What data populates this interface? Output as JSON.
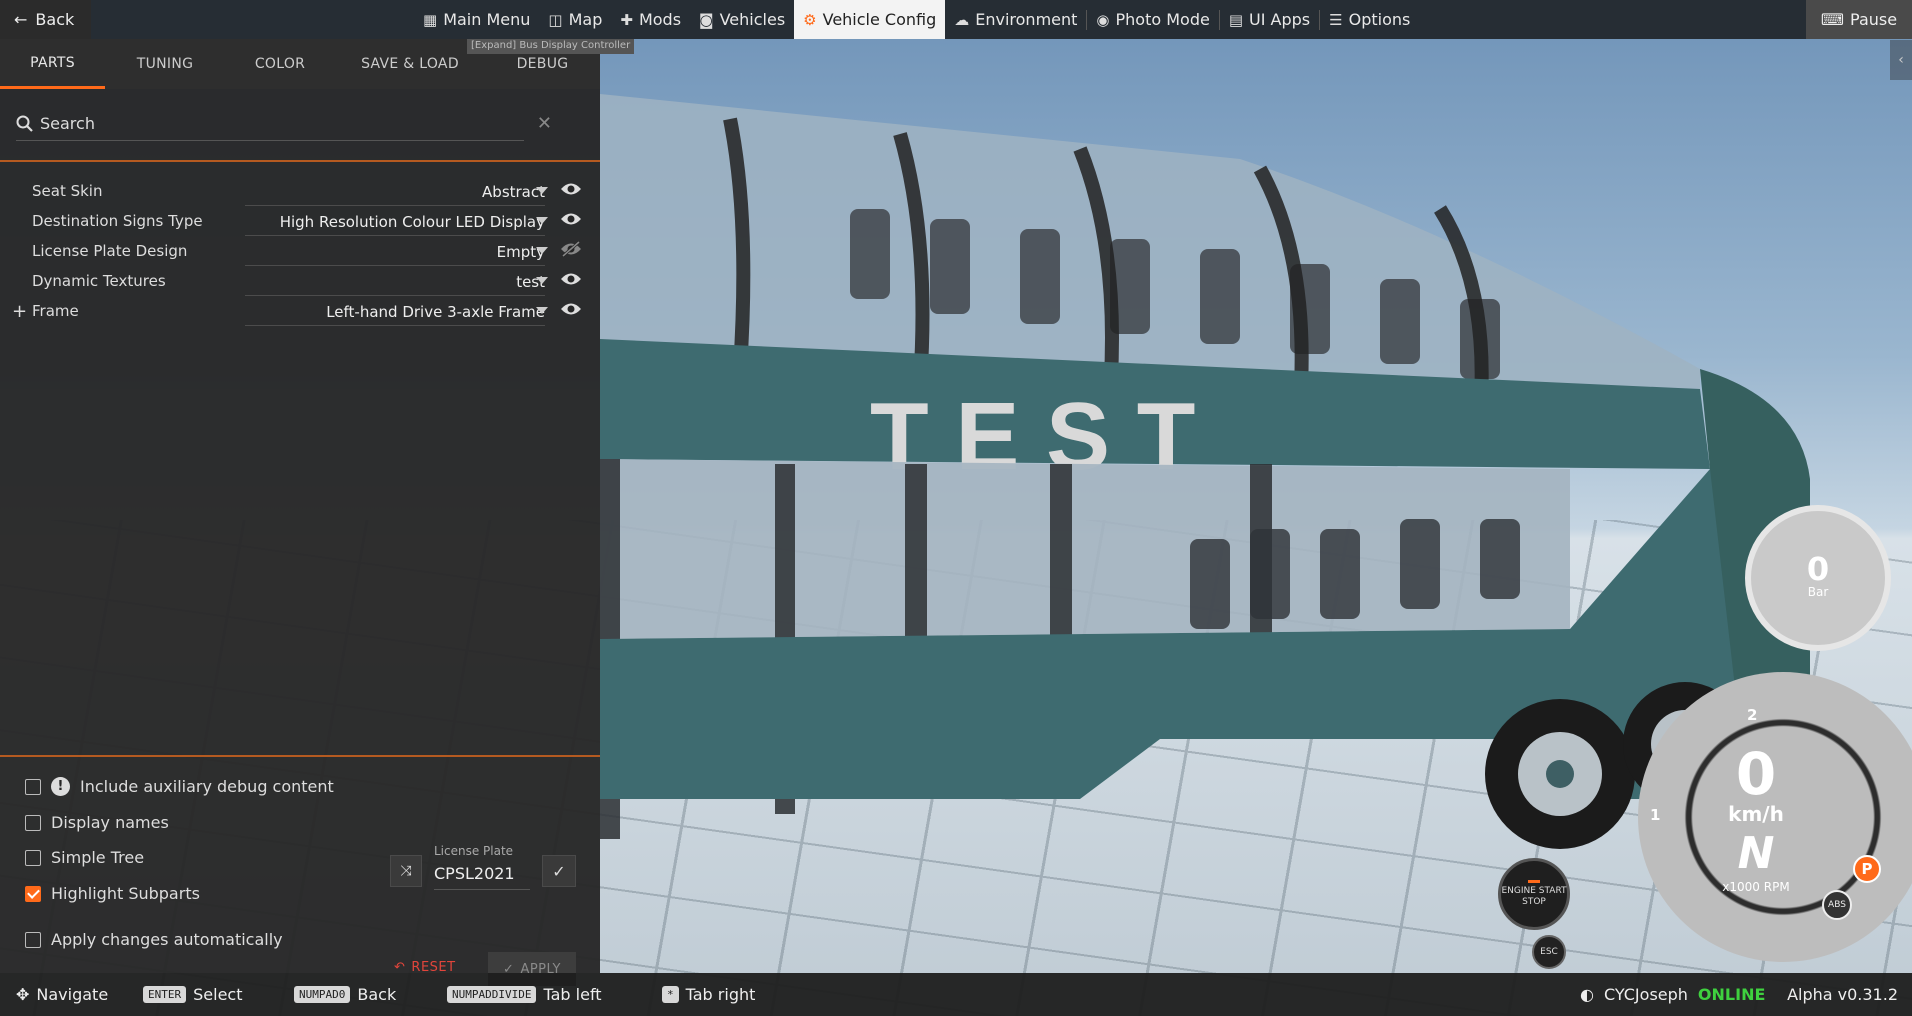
{
  "topbar": {
    "back_label": "Back",
    "nav": [
      {
        "label": "Main Menu",
        "icon": "main-menu-icon"
      },
      {
        "label": "Map",
        "icon": "map-icon"
      },
      {
        "label": "Mods",
        "icon": "puzzle-icon"
      },
      {
        "label": "Vehicles",
        "icon": "car-icon"
      },
      {
        "label": "Vehicle Config",
        "icon": "engine-icon",
        "active": true
      },
      {
        "label": "Environment",
        "icon": "weather-icon"
      },
      {
        "label": "Photo Mode",
        "icon": "camera-icon"
      },
      {
        "label": "UI Apps",
        "icon": "ui-apps-icon"
      },
      {
        "label": "Options",
        "icon": "sliders-icon"
      }
    ],
    "pause_label": "Pause"
  },
  "panel": {
    "tabs": [
      "PARTS",
      "TUNING",
      "COLOR",
      "SAVE & LOAD",
      "DEBUG"
    ],
    "active_tab": "PARTS",
    "tooltip": "[Expand] Bus Display Controller",
    "search_placeholder": "Search",
    "parts": [
      {
        "name": "Seat Skin",
        "value": "Abstract",
        "visible": true,
        "expandable": false
      },
      {
        "name": "Destination Signs Type",
        "value": "High Resolution Colour LED Display",
        "visible": true,
        "expandable": false
      },
      {
        "name": "License Plate Design",
        "value": "Empty",
        "visible": false,
        "expandable": false
      },
      {
        "name": "Dynamic Textures",
        "value": "test",
        "visible": true,
        "expandable": false
      },
      {
        "name": "Frame",
        "value": "Left-hand Drive 3-axle Frame",
        "visible": true,
        "expandable": true
      }
    ],
    "options": {
      "include_debug": {
        "label": "Include auxiliary debug content",
        "checked": false
      },
      "display_names": {
        "label": "Display names",
        "checked": false
      },
      "simple_tree": {
        "label": "Simple Tree",
        "checked": false
      },
      "highlight_subparts": {
        "label": "Highlight Subparts",
        "checked": true
      },
      "apply_auto": {
        "label": "Apply changes automatically",
        "checked": false
      }
    },
    "license_plate": {
      "label": "License Plate",
      "value": "CPSL2021"
    },
    "reset_label": "RESET",
    "apply_label": "APPLY"
  },
  "bottombar": {
    "hints": [
      {
        "key": "",
        "label": "Navigate"
      },
      {
        "key": "ENTER",
        "label": "Select"
      },
      {
        "key": "NUMPAD0",
        "label": "Back"
      },
      {
        "key": "NUMPADDIVIDE",
        "label": "Tab left"
      },
      {
        "key": "*",
        "label": "Tab right"
      }
    ],
    "username": "CYCJoseph",
    "status": "ONLINE",
    "version": "Alpha v0.31.2"
  },
  "scene": {
    "bus_text": "T E S T"
  },
  "hud": {
    "boost_value": "0",
    "boost_unit": "Bar",
    "speed_value": "0",
    "speed_unit": "km/h",
    "gear": "N",
    "rpm_label": "x1000 RPM",
    "engine_label": "ENGINE START STOP",
    "esc_label": "ESC",
    "abs_label": "ABS",
    "park_label": "P",
    "tick_2": "2",
    "tick_1": "1"
  },
  "colors": {
    "accent": "#ff6a1a",
    "online": "#3fd13f",
    "reset": "#e2453b",
    "bus_body": "#3e6b70"
  }
}
